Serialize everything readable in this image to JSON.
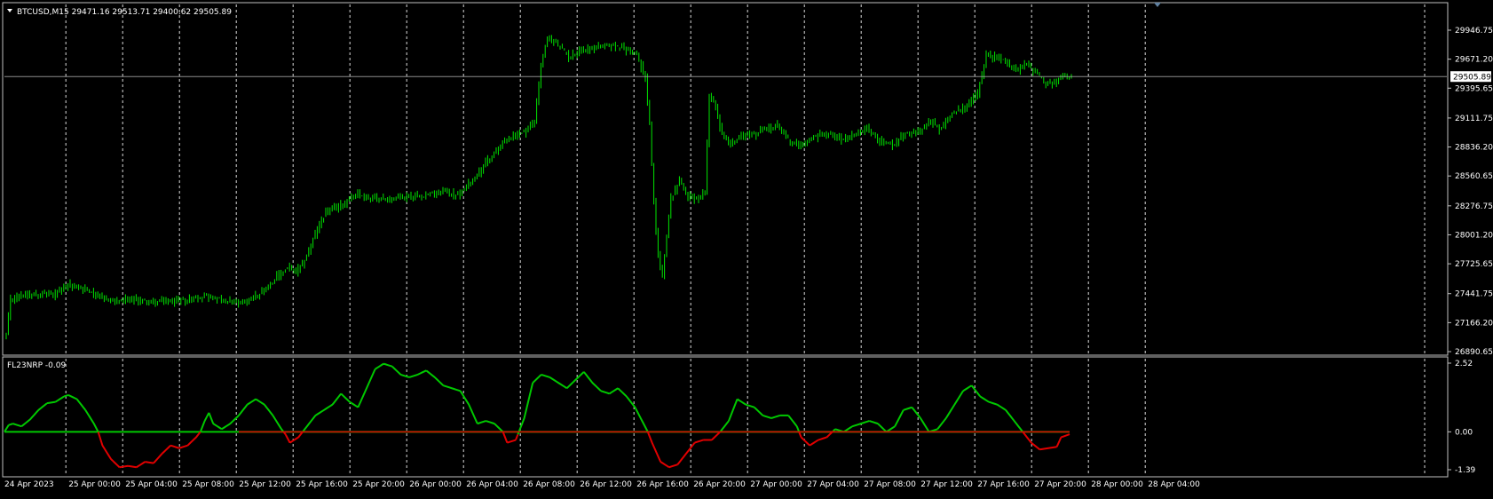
{
  "chart_data": [
    {
      "type": "candlestick",
      "title": "BTCUSD,M15  29471.16 29513.71 29400.62 29505.89",
      "symbol": "BTCUSD",
      "timeframe": "M15",
      "current_price_label": "29505.89",
      "ylim": [
        26890.65,
        30100
      ],
      "y_ticks": [
        "29946.75",
        "29671.20",
        "29395.65",
        "29111.75",
        "28836.20",
        "28560.65",
        "28276.75",
        "28001.20",
        "27725.65",
        "27441.75",
        "27166.20",
        "26890.65"
      ],
      "x_ticks": [
        "24 Apr 2023",
        "25 Apr 00:00",
        "25 Apr 04:00",
        "25 Apr 08:00",
        "25 Apr 12:00",
        "25 Apr 16:00",
        "25 Apr 20:00",
        "26 Apr 00:00",
        "26 Apr 04:00",
        "26 Apr 08:00",
        "26 Apr 12:00",
        "26 Apr 16:00",
        "26 Apr 20:00",
        "27 Apr 00:00",
        "27 Apr 04:00",
        "27 Apr 08:00",
        "27 Apr 12:00",
        "27 Apr 16:00",
        "27 Apr 20:00",
        "28 Apr 00:00",
        "28 Apr 04:00"
      ],
      "candles_per_tick": 16,
      "first_tick_offset_candles": 3.8,
      "anchor_closes": [
        [
          0,
          27050
        ],
        [
          2,
          27380
        ],
        [
          6,
          27430
        ],
        [
          14,
          27440
        ],
        [
          22,
          27430
        ],
        [
          30,
          27520
        ],
        [
          38,
          27480
        ],
        [
          46,
          27390
        ],
        [
          54,
          27370
        ],
        [
          62,
          27380
        ],
        [
          70,
          27360
        ],
        [
          78,
          27370
        ],
        [
          86,
          27390
        ],
        [
          94,
          27420
        ],
        [
          102,
          27370
        ],
        [
          110,
          27350
        ],
        [
          118,
          27430
        ],
        [
          126,
          27580
        ],
        [
          132,
          27690
        ],
        [
          136,
          27640
        ],
        [
          140,
          27760
        ],
        [
          144,
          27960
        ],
        [
          150,
          28220
        ],
        [
          158,
          28290
        ],
        [
          164,
          28390
        ],
        [
          172,
          28350
        ],
        [
          180,
          28340
        ],
        [
          190,
          28370
        ],
        [
          198,
          28380
        ],
        [
          206,
          28420
        ],
        [
          212,
          28370
        ],
        [
          220,
          28550
        ],
        [
          228,
          28760
        ],
        [
          236,
          28920
        ],
        [
          244,
          28990
        ],
        [
          248,
          29090
        ],
        [
          251,
          29610
        ],
        [
          254,
          29870
        ],
        [
          258,
          29830
        ],
        [
          264,
          29690
        ],
        [
          270,
          29760
        ],
        [
          278,
          29790
        ],
        [
          284,
          29800
        ],
        [
          290,
          29780
        ],
        [
          296,
          29710
        ],
        [
          300,
          29500
        ],
        [
          302,
          29050
        ],
        [
          304,
          28300
        ],
        [
          306,
          27800
        ],
        [
          308,
          27600
        ],
        [
          310,
          28000
        ],
        [
          312,
          28350
        ],
        [
          316,
          28520
        ],
        [
          320,
          28360
        ],
        [
          324,
          28330
        ],
        [
          328,
          28400
        ],
        [
          330,
          29330
        ],
        [
          332,
          29280
        ],
        [
          336,
          28960
        ],
        [
          340,
          28880
        ],
        [
          346,
          28950
        ],
        [
          352,
          28960
        ],
        [
          356,
          29010
        ],
        [
          362,
          29040
        ],
        [
          368,
          28880
        ],
        [
          374,
          28860
        ],
        [
          380,
          28940
        ],
        [
          386,
          28970
        ],
        [
          392,
          28920
        ],
        [
          398,
          28940
        ],
        [
          404,
          29010
        ],
        [
          410,
          28900
        ],
        [
          416,
          28850
        ],
        [
          422,
          28960
        ],
        [
          428,
          28980
        ],
        [
          434,
          29080
        ],
        [
          438,
          29000
        ],
        [
          444,
          29150
        ],
        [
          450,
          29210
        ],
        [
          456,
          29350
        ],
        [
          460,
          29710
        ],
        [
          464,
          29690
        ],
        [
          470,
          29640
        ],
        [
          474,
          29560
        ],
        [
          478,
          29630
        ],
        [
          484,
          29530
        ],
        [
          488,
          29420
        ],
        [
          492,
          29440
        ],
        [
          496,
          29510
        ],
        [
          500,
          29505.89
        ]
      ]
    },
    {
      "type": "line",
      "title": "FL23NRP -0.09",
      "indicator_name": "FL23NRP",
      "indicator_value": "-0.09",
      "ylim": [
        -1.39,
        2.52
      ],
      "y_ticks": [
        "2.52",
        "0.00",
        "-1.39"
      ],
      "series": [],
      "green_color": "#00c800",
      "red_color": "#e00000",
      "zero_line_colors": [
        "#00c800",
        "#e00000"
      ],
      "anchors": [
        [
          0,
          0.0
        ],
        [
          2,
          0.25
        ],
        [
          4,
          0.3
        ],
        [
          8,
          0.2
        ],
        [
          12,
          0.45
        ],
        [
          16,
          0.8
        ],
        [
          20,
          1.05
        ],
        [
          24,
          1.1
        ],
        [
          28,
          1.3
        ],
        [
          30,
          1.35
        ],
        [
          34,
          1.2
        ],
        [
          38,
          0.8
        ],
        [
          42,
          0.3
        ],
        [
          44,
          0.0
        ],
        [
          46,
          -0.5
        ],
        [
          50,
          -1.0
        ],
        [
          54,
          -1.3
        ],
        [
          58,
          -1.25
        ],
        [
          62,
          -1.3
        ],
        [
          66,
          -1.1
        ],
        [
          70,
          -1.15
        ],
        [
          74,
          -0.8
        ],
        [
          78,
          -0.5
        ],
        [
          82,
          -0.6
        ],
        [
          86,
          -0.5
        ],
        [
          90,
          -0.2
        ],
        [
          92,
          0.0
        ],
        [
          94,
          0.4
        ],
        [
          96,
          0.7
        ],
        [
          98,
          0.3
        ],
        [
          102,
          0.1
        ],
        [
          106,
          0.3
        ],
        [
          110,
          0.6
        ],
        [
          114,
          1.0
        ],
        [
          118,
          1.2
        ],
        [
          122,
          1.0
        ],
        [
          126,
          0.6
        ],
        [
          130,
          0.1
        ],
        [
          132,
          -0.1
        ],
        [
          134,
          -0.4
        ],
        [
          138,
          -0.2
        ],
        [
          142,
          0.2
        ],
        [
          146,
          0.6
        ],
        [
          150,
          0.8
        ],
        [
          154,
          1.0
        ],
        [
          158,
          1.4
        ],
        [
          162,
          1.1
        ],
        [
          166,
          0.9
        ],
        [
          170,
          1.6
        ],
        [
          174,
          2.3
        ],
        [
          178,
          2.5
        ],
        [
          182,
          2.4
        ],
        [
          186,
          2.1
        ],
        [
          190,
          2.0
        ],
        [
          194,
          2.1
        ],
        [
          198,
          2.25
        ],
        [
          202,
          2.0
        ],
        [
          206,
          1.7
        ],
        [
          210,
          1.6
        ],
        [
          214,
          1.5
        ],
        [
          218,
          1.0
        ],
        [
          222,
          0.3
        ],
        [
          226,
          0.4
        ],
        [
          230,
          0.3
        ],
        [
          234,
          0.0
        ],
        [
          236,
          -0.4
        ],
        [
          238,
          -0.35
        ],
        [
          240,
          -0.3
        ],
        [
          244,
          0.5
        ],
        [
          248,
          1.8
        ],
        [
          252,
          2.1
        ],
        [
          256,
          2.0
        ],
        [
          260,
          1.8
        ],
        [
          264,
          1.6
        ],
        [
          268,
          1.9
        ],
        [
          272,
          2.2
        ],
        [
          276,
          1.8
        ],
        [
          280,
          1.5
        ],
        [
          284,
          1.4
        ],
        [
          288,
          1.6
        ],
        [
          292,
          1.3
        ],
        [
          296,
          0.9
        ],
        [
          300,
          0.3
        ],
        [
          302,
          0.0
        ],
        [
          304,
          -0.4
        ],
        [
          308,
          -1.1
        ],
        [
          312,
          -1.3
        ],
        [
          316,
          -1.2
        ],
        [
          320,
          -0.8
        ],
        [
          324,
          -0.4
        ],
        [
          328,
          -0.3
        ],
        [
          332,
          -0.3
        ],
        [
          336,
          0.0
        ],
        [
          340,
          0.4
        ],
        [
          344,
          1.2
        ],
        [
          348,
          1.0
        ],
        [
          352,
          0.9
        ],
        [
          356,
          0.6
        ],
        [
          360,
          0.5
        ],
        [
          364,
          0.6
        ],
        [
          368,
          0.6
        ],
        [
          372,
          0.2
        ],
        [
          374,
          -0.2
        ],
        [
          378,
          -0.5
        ],
        [
          382,
          -0.3
        ],
        [
          386,
          -0.2
        ],
        [
          390,
          0.1
        ],
        [
          394,
          0.0
        ],
        [
          398,
          0.2
        ],
        [
          402,
          0.3
        ],
        [
          406,
          0.4
        ],
        [
          410,
          0.3
        ],
        [
          414,
          0.0
        ],
        [
          418,
          0.2
        ],
        [
          422,
          0.8
        ],
        [
          426,
          0.9
        ],
        [
          430,
          0.5
        ],
        [
          434,
          0.0
        ],
        [
          438,
          0.1
        ],
        [
          442,
          0.5
        ],
        [
          446,
          1.0
        ],
        [
          450,
          1.5
        ],
        [
          454,
          1.7
        ],
        [
          458,
          1.3
        ],
        [
          462,
          1.1
        ],
        [
          466,
          1.0
        ],
        [
          470,
          0.8
        ],
        [
          474,
          0.4
        ],
        [
          478,
          0.0
        ],
        [
          482,
          -0.4
        ],
        [
          486,
          -0.65
        ],
        [
          490,
          -0.6
        ],
        [
          494,
          -0.55
        ],
        [
          496,
          -0.2
        ],
        [
          500,
          -0.09
        ]
      ]
    }
  ],
  "grid": "dashed vertical",
  "colors": {
    "background": "#000000",
    "candle_color": "#00e600",
    "frame": "#c0c0c0",
    "text": "#ffffff",
    "price_line": "#b0b0b0",
    "grid": "#ffffff"
  }
}
